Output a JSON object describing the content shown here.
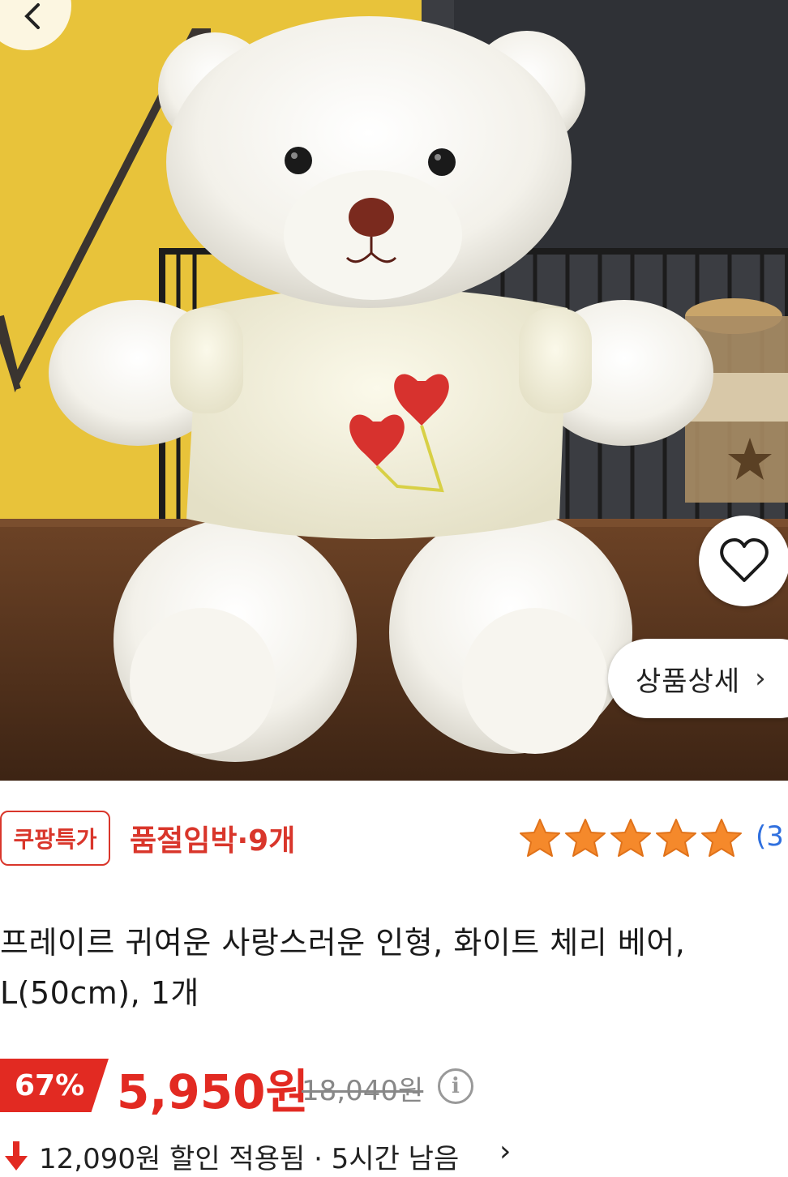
{
  "product_image": {
    "subject": "white-teddy-bear-photo"
  },
  "controls": {
    "back_icon": "chevron-left-icon",
    "wishlist_icon": "heart-outline-icon",
    "detail_label": "상품상세",
    "detail_chevron": "›"
  },
  "badges": {
    "promo_label": "쿠팡특가",
    "stock_status": "품절임박·9개",
    "rating_stars": 5,
    "review_count": "(3"
  },
  "product": {
    "title_line1": "프레이르 귀여운 사랑스러운 인형, 화이트 체리 베어,",
    "title_line2": "L(50cm), 1개"
  },
  "price": {
    "discount_percent": "67%",
    "sale_price": "5,950원",
    "original_price": "18,040원",
    "info_icon": "ⓘ"
  },
  "discount_notice": {
    "text": "12,090원 할인 적용됨 · 5시간 남음",
    "chevron": "›"
  },
  "colors": {
    "accent_red": "#e22a22",
    "star_orange": "#f5892b",
    "link_blue": "#2f6fde"
  }
}
